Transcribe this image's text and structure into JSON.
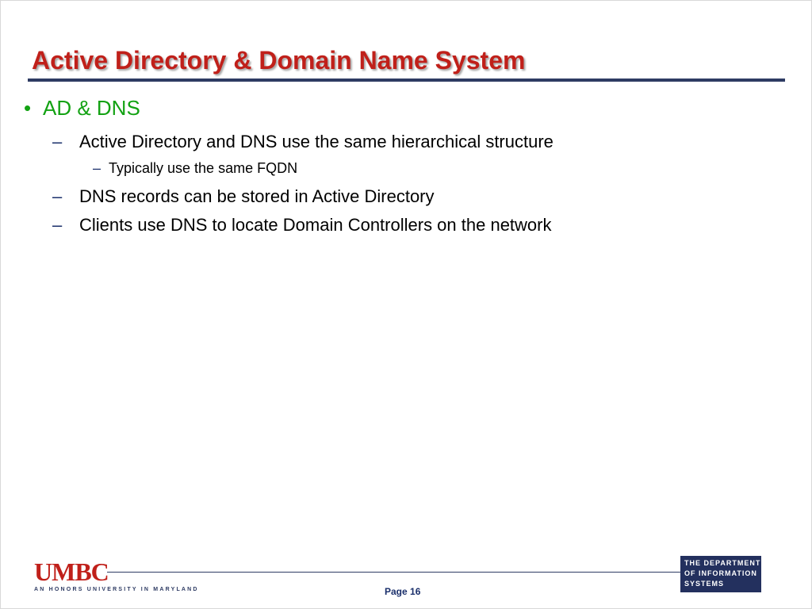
{
  "slide": {
    "title": "Active Directory & Domain Name System",
    "bullets": {
      "level1": {
        "marker": "•",
        "text": "AD & DNS"
      },
      "items": [
        {
          "marker": "–",
          "text": "Active Directory and DNS use the same hierarchical structure"
        },
        {
          "marker": "–",
          "text": "Typically use the same FQDN"
        },
        {
          "marker": "–",
          "text": "DNS records can be stored in Active Directory"
        },
        {
          "marker": "–",
          "text": "Clients use DNS to locate Domain Controllers on the network"
        }
      ]
    }
  },
  "footer": {
    "umbc_logo_text": "UMBC",
    "umbc_tagline": "AN HONORS UNIVERSITY IN MARYLAND",
    "page_label": "Page 16",
    "department_logo": {
      "line1": "THE DEPARTMENT",
      "line2": "OF INFORMATION",
      "line3": "SYSTEMS"
    }
  },
  "colors": {
    "title": "#c0201a",
    "level1_text": "#13a213",
    "rule": "#2e3b63",
    "department_logo_bg": "#23305e"
  }
}
